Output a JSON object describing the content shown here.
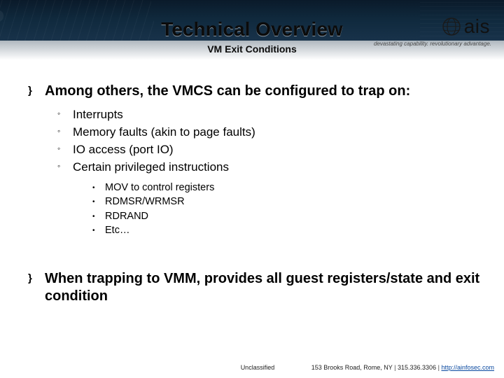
{
  "header": {
    "title": "Technical Overview",
    "subtitle": "VM Exit Conditions",
    "logo_text": "ais",
    "tagline": "devastating capability. revolutionary advantage."
  },
  "content": {
    "bullets": [
      {
        "marker": "}",
        "text": "Among others, the VMCS can be configured to trap on:",
        "sub": [
          {
            "marker": "◦",
            "text": "Interrupts"
          },
          {
            "marker": "◦",
            "text": "Memory faults (akin to page faults)"
          },
          {
            "marker": "◦",
            "text": "IO access (port IO)"
          },
          {
            "marker": "◦",
            "text": "Certain privileged instructions",
            "sub": [
              {
                "marker": "•",
                "text": "MOV to control registers"
              },
              {
                "marker": "•",
                "text": "RDMSR/WRMSR"
              },
              {
                "marker": "•",
                "text": "RDRAND"
              },
              {
                "marker": "•",
                "text": "Etc…"
              }
            ]
          }
        ]
      },
      {
        "marker": "}",
        "text": "When trapping to VMM, provides all guest registers/state and exit condition"
      }
    ]
  },
  "footer": {
    "classification": "Unclassified",
    "address": "153 Brooks Road, Rome, NY",
    "phone": "315.336.3306",
    "url_text": "http://ainfosec.com",
    "separator": "|"
  }
}
